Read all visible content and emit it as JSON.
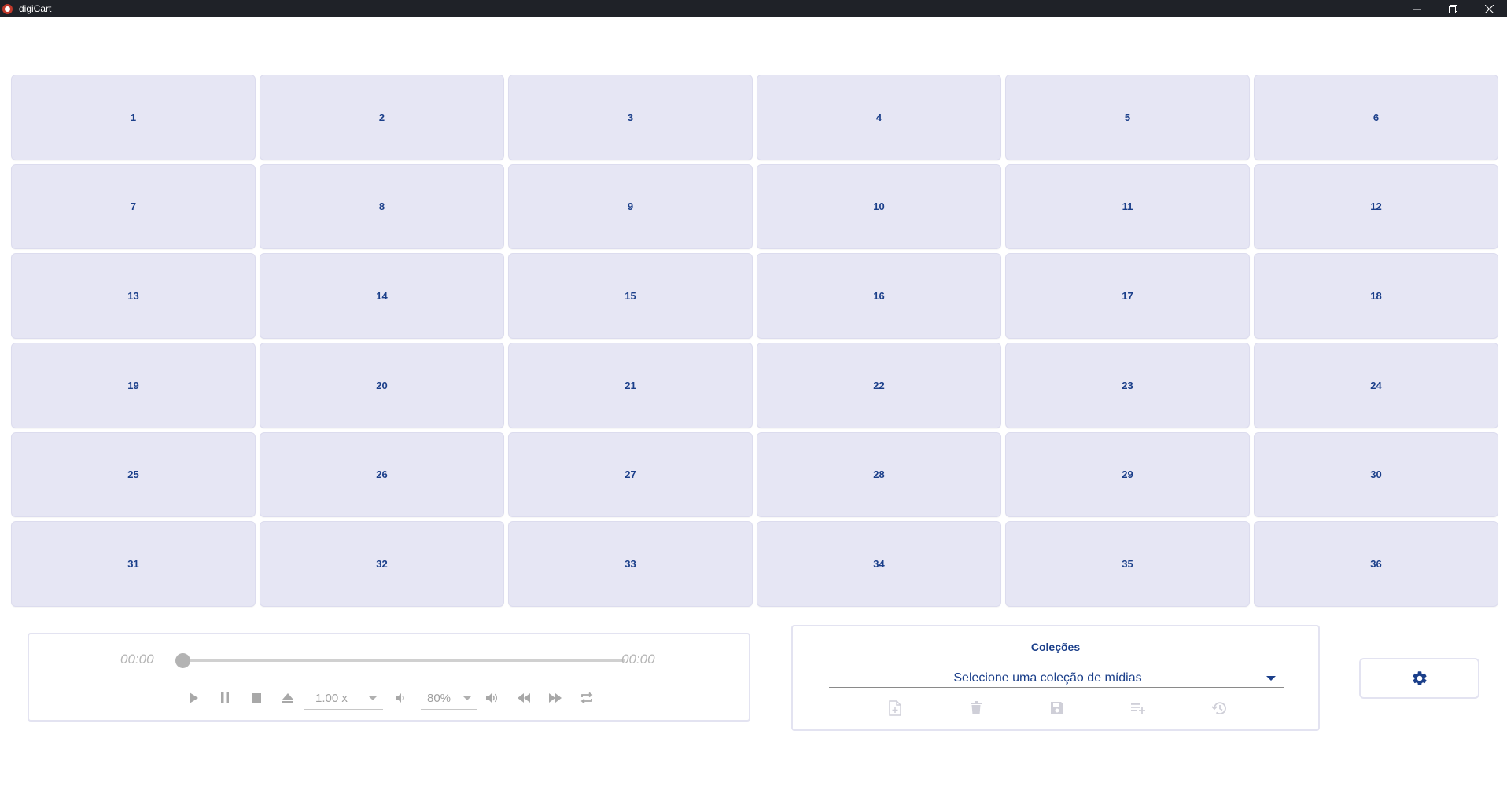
{
  "window": {
    "title": "digiCart",
    "controls": [
      "minimize-icon",
      "restore-icon",
      "close-icon"
    ]
  },
  "carts": [
    "1",
    "2",
    "3",
    "4",
    "5",
    "6",
    "7",
    "8",
    "9",
    "10",
    "11",
    "12",
    "13",
    "14",
    "15",
    "16",
    "17",
    "18",
    "19",
    "20",
    "21",
    "22",
    "23",
    "24",
    "25",
    "26",
    "27",
    "28",
    "29",
    "30",
    "31",
    "32",
    "33",
    "34",
    "35",
    "36"
  ],
  "player": {
    "elapsed": "00:00",
    "remaining": "00:00",
    "progress": 0,
    "speed": "1.00 x",
    "volume": "80%",
    "controls": [
      "play-icon",
      "pause-icon",
      "stop-icon",
      "eject-icon",
      "volume-down-icon",
      "volume-up-icon",
      "rewind-icon",
      "fast-forward-icon",
      "repeat-icon"
    ]
  },
  "collections": {
    "title": "Coleções",
    "select_placeholder": "Selecione uma coleção de mídias",
    "actions": [
      "new-file-icon",
      "delete-icon",
      "save-icon",
      "playlist-add-icon",
      "history-icon"
    ]
  },
  "settings": {
    "icon": "gear-icon"
  },
  "colors": {
    "accent": "#1b3f8a",
    "cart_bg": "#e6e6f4",
    "titlebar_bg": "#1f2228",
    "disabled": "#b0b0b0"
  }
}
